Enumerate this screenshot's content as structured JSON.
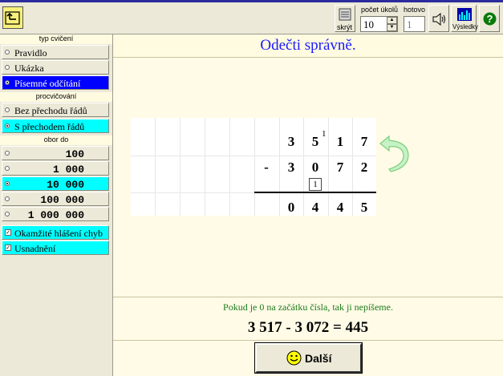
{
  "toolbar": {
    "skryt_label": "skrýt",
    "pocet_label": "počet úkolů",
    "pocet_value": "10",
    "hotovo_label": "hotovo",
    "hotovo_value": "1",
    "vysledky_label": "Výsledky",
    "help_label": "?"
  },
  "sidebar": {
    "typ_label": "typ cvičení",
    "typ_items": [
      {
        "label": "Pravidlo",
        "selected": false
      },
      {
        "label": "Ukázka",
        "selected": false
      },
      {
        "label": "Písemné odčítání",
        "selected": true
      }
    ],
    "procvic_label": "procvičování",
    "procvic_items": [
      {
        "label": "Bez přechodu řádů",
        "selected": false
      },
      {
        "label": "S přechodem řádů",
        "selected": true
      }
    ],
    "obor_label": "obor do",
    "obor_items": [
      {
        "label": "100",
        "selected": false
      },
      {
        "label": "1 000",
        "selected": false
      },
      {
        "label": "10 000",
        "selected": true
      },
      {
        "label": "100 000",
        "selected": false
      },
      {
        "label": "1 000 000",
        "selected": false
      }
    ],
    "checks": [
      {
        "label": "Okamžité hlášení chyb",
        "checked": true
      },
      {
        "label": "Usnadnění",
        "checked": true
      }
    ]
  },
  "main": {
    "title": "Odečti správně.",
    "minuend": [
      "3",
      "5",
      "1",
      "7"
    ],
    "minus_sign": "-",
    "subtrahend": [
      "3",
      "0",
      "7",
      "2"
    ],
    "result": [
      "0",
      "4",
      "4",
      "5"
    ],
    "carry_mark": "1",
    "borrow_value": "1",
    "hint": "Pokud je 0 na začátku čísla, tak ji nepíšeme.",
    "equation": "3 517 - 3 072 = 445",
    "next_label": "Další"
  },
  "colors": {
    "selected_blue": "#0000ff",
    "selected_cyan": "#00ffff",
    "title_blue": "#1a1aff",
    "hint_green": "#1a7a1a",
    "arrow_green": "#9fe49f"
  }
}
